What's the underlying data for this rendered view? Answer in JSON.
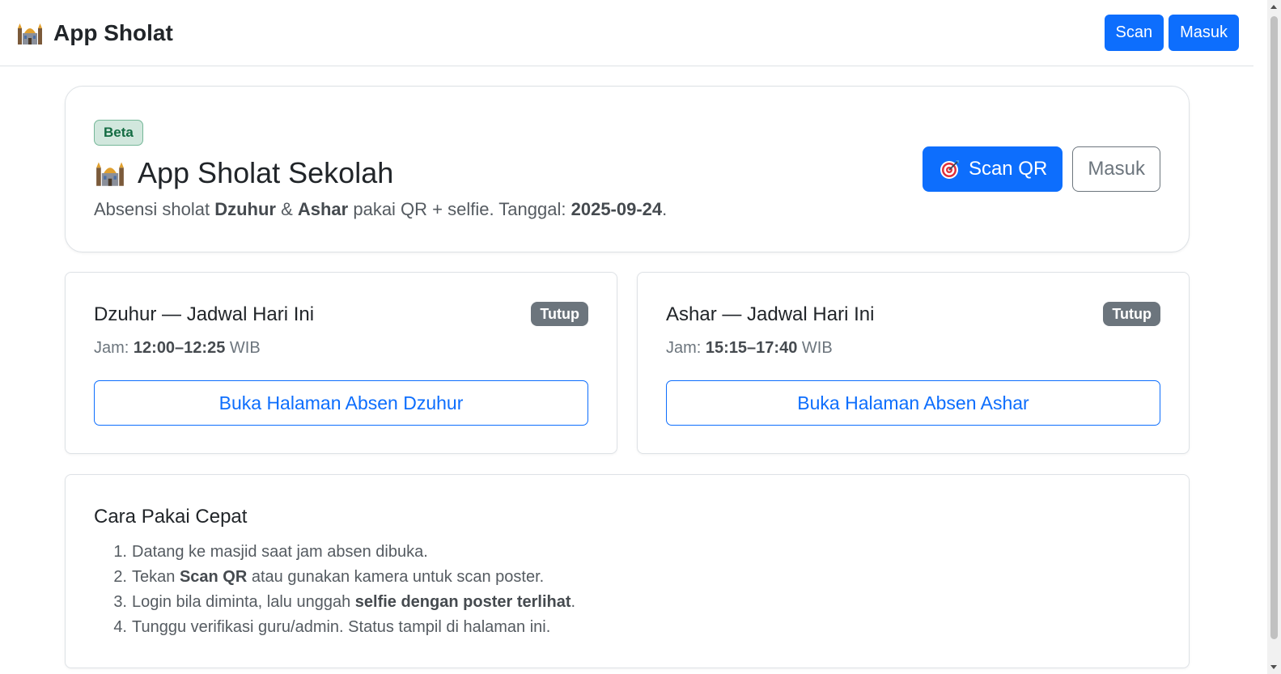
{
  "navbar": {
    "brand": "App Sholat",
    "brand_icon": "mosque-icon",
    "scan_label": "Scan",
    "login_label": "Masuk"
  },
  "hero": {
    "badge": "Beta",
    "title": "App Sholat Sekolah",
    "title_icon": "mosque-icon",
    "subtitle": {
      "prefix": "Absensi sholat ",
      "prayer1": "Dzuhur",
      "amp": " & ",
      "prayer2": "Ashar",
      "middle": " pakai QR + selfie. Tanggal: ",
      "date": "2025-09-24",
      "suffix": "."
    },
    "scan_qr_label": "Scan QR",
    "scan_qr_icon": "target-icon",
    "login_label": "Masuk"
  },
  "schedules": [
    {
      "title": "Dzuhur — Jadwal Hari Ini",
      "status": "Tutup",
      "jam_label": "Jam: ",
      "time": "12:00–12:25",
      "zone": " WIB",
      "button": "Buka Halaman Absen Dzuhur"
    },
    {
      "title": "Ashar — Jadwal Hari Ini",
      "status": "Tutup",
      "jam_label": "Jam: ",
      "time": "15:15–17:40",
      "zone": " WIB",
      "button": "Buka Halaman Absen Ashar"
    }
  ],
  "help": {
    "title": "Cara Pakai Cepat",
    "steps": [
      {
        "num": "1.",
        "a": "Datang ke masjid saat jam absen dibuka.",
        "b": "",
        "c": ""
      },
      {
        "num": "2.",
        "a": "Tekan ",
        "b": "Scan QR",
        "c": " atau gunakan kamera untuk scan poster."
      },
      {
        "num": "3.",
        "a": "Login bila diminta, lalu unggah ",
        "b": "selfie dengan poster terlihat",
        "c": "."
      },
      {
        "num": "4.",
        "a": "Tunggu verifikasi guru/admin. Status tampil di halaman ini.",
        "b": "",
        "c": ""
      }
    ]
  },
  "colors": {
    "primary": "#0d6efd",
    "secondary": "#6c757d",
    "success_bg": "#d1e7dd",
    "success_text": "#146c43"
  }
}
